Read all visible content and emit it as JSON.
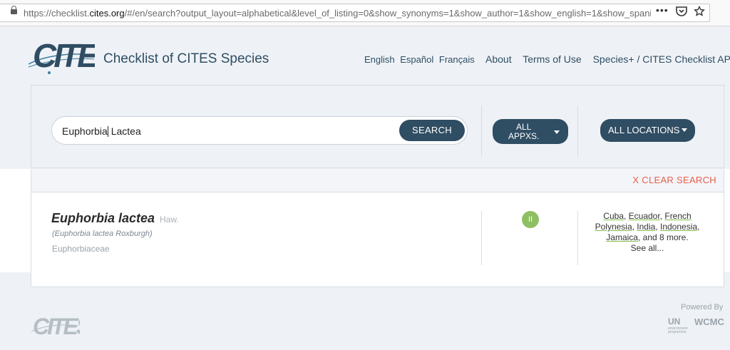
{
  "browser": {
    "url_prefix": "https://checklist.",
    "url_domain": "cites.org",
    "url_suffix": "/#/en/search?output_layout=alphabetical&level_of_listing=0&show_synonyms=1&show_author=1&show_english=1&show_spani"
  },
  "header": {
    "logo_text": "CITES",
    "title": "Checklist of CITES Species",
    "languages": [
      "English",
      "Español",
      "Français"
    ],
    "nav": [
      "About",
      "Terms of Use",
      "Species+ / CITES Checklist API"
    ]
  },
  "search": {
    "value_part1": "Euphorbia",
    "value_part2": " Lactea",
    "button": "SEARCH",
    "appendices_line1": "ALL",
    "appendices_line2": "APPXS.",
    "locations": "ALL LOCATIONS",
    "clear": "X CLEAR SEARCH"
  },
  "result": {
    "name": "Euphorbia lactea",
    "author": "Haw.",
    "synonym": "(Euphorbia lactea Roxburgh)",
    "family": "Euphorbiaceae",
    "appendix": "II",
    "loc_line1": [
      "Cuba",
      "Ecuador",
      "French"
    ],
    "loc_line2": [
      "Polynesia",
      "India",
      "Indonesia"
    ],
    "loc_line3_link": "Jamaica",
    "loc_line3_rest": ", and 8 more.",
    "see_all": "See all..."
  },
  "footer": {
    "logo_text": "CITES",
    "powered_by": "Powered By",
    "un": "UN",
    "un_sub1": "environment",
    "un_sub2": "programme",
    "wcmc": "WCMC"
  },
  "colors": {
    "primary": "#2f4d63",
    "accent_red": "#e85d4c",
    "appendix_green": "#8fbf63",
    "background": "#eef2f6"
  }
}
